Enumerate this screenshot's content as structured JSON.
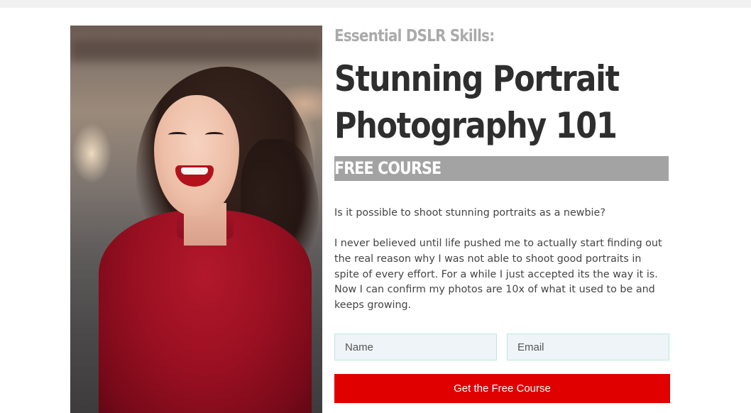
{
  "photo": {
    "subject": "portrait-woman-red-top",
    "accent_color": "#9a1022"
  },
  "hero": {
    "kicker": "Essential DSLR Skills:",
    "headline_line1": "Stunning Portrait",
    "headline_line2": "Photography 101",
    "badge": "FREE COURSE"
  },
  "copy": {
    "intro": "Is it possible to shoot stunning portraits as a newbie?",
    "story": "I never believed until life pushed me to actually start finding out the real reason why I was not able to shoot good portraits in spite of every effort. For a while I just accepted its the way it is. Now I can confirm my photos are 10x of what it used to be and keeps growing."
  },
  "form": {
    "name_placeholder": "Name",
    "email_placeholder": "Email",
    "submit_label": "Get the Free Course"
  },
  "colors": {
    "cta": "#e00000",
    "badge_bg": "#a3a3a3",
    "kicker": "#aaaaaa",
    "headline": "#2e2e2e",
    "field_border": "#bfe6df",
    "field_bg": "#eef4f8"
  }
}
